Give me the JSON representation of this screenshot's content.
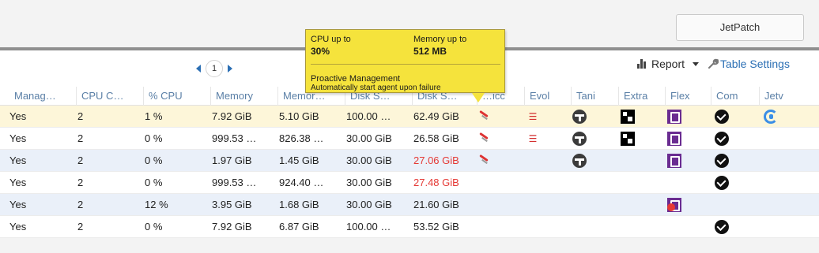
{
  "header": {
    "brand_button": "JetPatch"
  },
  "pager": {
    "current_page": "1"
  },
  "toolbar": {
    "report_label": "Report",
    "table_settings_label": "Table Settings"
  },
  "table": {
    "columns": [
      "Manag…",
      "CPU C…",
      "% CPU",
      "Memory",
      "Memor…",
      "Disk S…",
      "Disk S…",
      "…icc",
      "Evol",
      "Tani",
      "Extra",
      "Flex",
      "Com",
      "Jetv"
    ],
    "rows": [
      {
        "managed": "Yes",
        "cpu_cores": "2",
        "cpu_pct": "1 %",
        "memory": "7.92 GiB",
        "memory_free": "5.10 GiB",
        "disk_size": "100.00 …",
        "disk_free": "62.49 GiB",
        "disk_free_warn": false,
        "icons": {
          "probe": true,
          "evol": true,
          "tani": true,
          "extra": true,
          "flex": "ok",
          "com": true,
          "jetv": true
        }
      },
      {
        "managed": "Yes",
        "cpu_cores": "2",
        "cpu_pct": "0 %",
        "memory": "999.53 …",
        "memory_free": "826.38 …",
        "disk_size": "30.00 GiB",
        "disk_free": "26.58 GiB",
        "disk_free_warn": false,
        "icons": {
          "probe": true,
          "evol": true,
          "tani": true,
          "extra": true,
          "flex": "ok",
          "com": true,
          "jetv": false
        }
      },
      {
        "managed": "Yes",
        "cpu_cores": "2",
        "cpu_pct": "0 %",
        "memory": "1.97 GiB",
        "memory_free": "1.45 GiB",
        "disk_size": "30.00 GiB",
        "disk_free": "27.06 GiB",
        "disk_free_warn": true,
        "icons": {
          "probe": true,
          "evol": false,
          "tani": true,
          "extra": false,
          "flex": "ok",
          "com": true,
          "jetv": false
        }
      },
      {
        "managed": "Yes",
        "cpu_cores": "2",
        "cpu_pct": "0 %",
        "memory": "999.53 …",
        "memory_free": "924.40 …",
        "disk_size": "30.00 GiB",
        "disk_free": "27.48 GiB",
        "disk_free_warn": true,
        "icons": {
          "probe": false,
          "evol": false,
          "tani": false,
          "extra": false,
          "flex": "none",
          "com": true,
          "jetv": false
        }
      },
      {
        "managed": "Yes",
        "cpu_cores": "2",
        "cpu_pct": "12 %",
        "memory": "3.95 GiB",
        "memory_free": "1.68 GiB",
        "disk_size": "30.00 GiB",
        "disk_free": "21.60 GiB",
        "disk_free_warn": false,
        "icons": {
          "probe": false,
          "evol": false,
          "tani": false,
          "extra": false,
          "flex": "error",
          "com": false,
          "jetv": false
        }
      },
      {
        "managed": "Yes",
        "cpu_cores": "2",
        "cpu_pct": "0 %",
        "memory": "7.92 GiB",
        "memory_free": "6.87 GiB",
        "disk_size": "100.00 …",
        "disk_free": "53.52 GiB",
        "disk_free_warn": false,
        "icons": {
          "probe": false,
          "evol": false,
          "tani": false,
          "extra": false,
          "flex": "none",
          "com": true,
          "jetv": false
        }
      }
    ]
  },
  "tooltip": {
    "cpu_label": "CPU up to",
    "cpu_value": "30%",
    "memory_label": "Memory up to",
    "memory_value": "512 MB",
    "policy_label": "Proactive Management",
    "policy_value": "Automatically start agent upon failure"
  },
  "colors": {
    "accent": "#2b6fb4",
    "warn": "#e53935",
    "highlight_row": "#fdf6d9",
    "alt_row": "#eaf0f9",
    "tooltip_bg": "#f5e33c"
  }
}
